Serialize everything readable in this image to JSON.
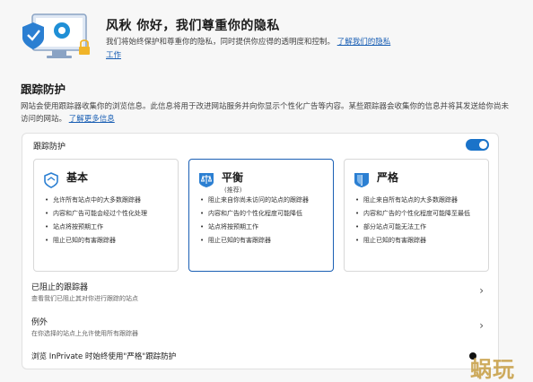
{
  "hero": {
    "title": "风秋 你好，我们尊重你的隐私",
    "desc_line1": "我们将始终保护和尊重你的隐私，同时提供你应得的透明度和控制。",
    "link_part1": "了解我们的隐私",
    "link_part2": "工作"
  },
  "tracking": {
    "title": "跟踪防护",
    "desc": "网站会使用跟踪器收集你的浏览信息。此信息将用于改进网站服务并向你显示个性化广告等内容。某些跟踪器会收集你的信息并将其发送给你尚未访问的网站。",
    "more_link": "了解更多信息"
  },
  "panel": {
    "toggle_label": "跟踪防护",
    "cards": [
      {
        "title": "基本",
        "subtitle": "",
        "icon": "scale-outline-icon",
        "items": [
          "允许所有站点中的大多数跟踪器",
          "内容和广告可能会经过个性化处理",
          "站点将按预期工作",
          "阻止已知的有害跟踪器"
        ]
      },
      {
        "title": "平衡",
        "subtitle": "(推荐)",
        "icon": "balance-icon",
        "items": [
          "阻止来自你尚未访问的站点的跟踪器",
          "内容和广告的个性化程度可能降低",
          "站点将按预期工作",
          "阻止已知的有害跟踪器"
        ]
      },
      {
        "title": "严格",
        "subtitle": "",
        "icon": "shield-icon",
        "items": [
          "阻止来自所有站点的大多数跟踪器",
          "内容和广告的个性化程度可能降至最低",
          "部分站点可能无法工作",
          "阻止已知的有害跟踪器"
        ]
      }
    ],
    "blocked": {
      "title": "已阻止的跟踪器",
      "subtitle": "查看我们已阻止其对你进行跟踪的站点"
    },
    "exceptions": {
      "title": "例外",
      "subtitle": "在你选择的站点上允许使用所有跟踪器"
    },
    "inprivate_label": "浏览 InPrivate 时始终使用\"严格\"跟踪防护"
  },
  "watermark": "蜗玩",
  "colors": {
    "accent": "#1a5fb4",
    "toggle": "#1a73c9"
  }
}
